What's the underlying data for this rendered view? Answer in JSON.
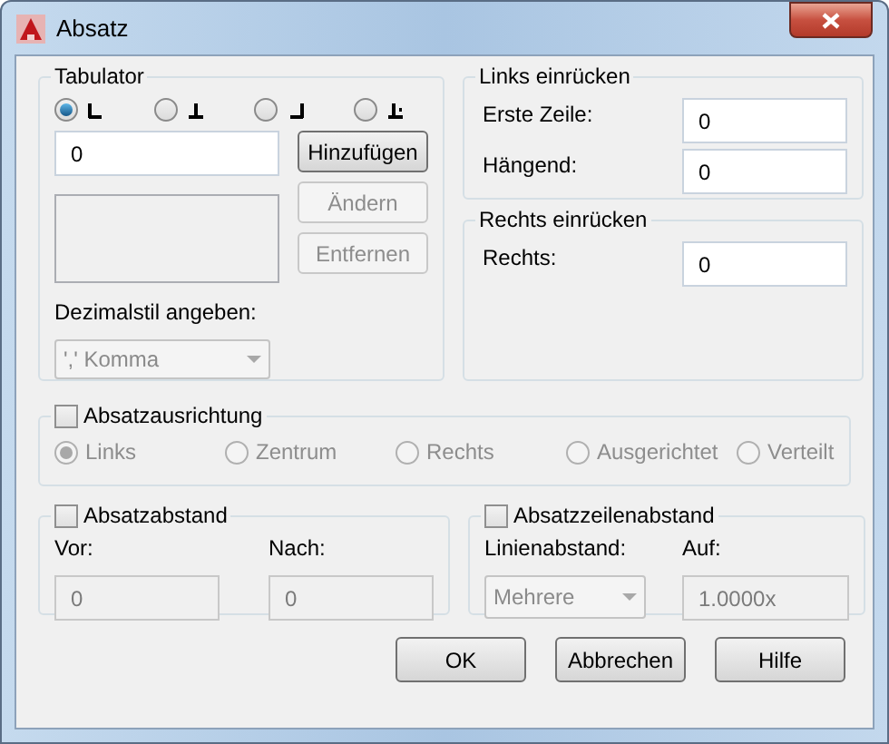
{
  "window": {
    "title": "Absatz"
  },
  "tabulator": {
    "title": "Tabulator",
    "tab_types": [
      {
        "kind": "left",
        "selected": true
      },
      {
        "kind": "center",
        "selected": false
      },
      {
        "kind": "right",
        "selected": false
      },
      {
        "kind": "decimal",
        "selected": false
      }
    ],
    "position": {
      "value": "0"
    },
    "buttons": [
      {
        "label": "Hinzufügen",
        "disabled": false
      },
      {
        "label": "Ändern",
        "disabled": true
      },
      {
        "label": "Entfernen",
        "disabled": true
      }
    ],
    "decimal_label": "Dezimalstil angeben:",
    "decimal_select": {
      "value": "',' Komma",
      "disabled": true
    }
  },
  "left_indent": {
    "title": "Links einrücken",
    "fields": [
      {
        "label": "Erste Zeile:",
        "value": "0"
      },
      {
        "label": "Hängend:",
        "value": "0"
      }
    ]
  },
  "right_indent": {
    "title": "Rechts einrücken",
    "fields": [
      {
        "label": "Rechts:",
        "value": "0"
      }
    ]
  },
  "alignment": {
    "label": "Absatzausrichtung",
    "checked": false,
    "options": [
      {
        "label": "Links",
        "selected": true,
        "disabled": true
      },
      {
        "label": "Zentrum",
        "selected": false,
        "disabled": true
      },
      {
        "label": "Rechts",
        "selected": false,
        "disabled": true
      },
      {
        "label": "Ausgerichtet",
        "selected": false,
        "disabled": true
      },
      {
        "label": "Verteilt",
        "selected": false,
        "disabled": true
      }
    ]
  },
  "spacing": {
    "label": "Absatzabstand",
    "checked": false,
    "fields": [
      {
        "label": "Vor:",
        "value": "0",
        "disabled": true
      },
      {
        "label": "Nach:",
        "value": "0",
        "disabled": true
      }
    ]
  },
  "line_spacing": {
    "label": "Absatzzeilenabstand",
    "checked": false,
    "type_label": "Linienabstand:",
    "type_value": "Mehrere",
    "type_disabled": true,
    "at_label": "Auf:",
    "at_value": "1.0000x",
    "at_disabled": true
  },
  "buttons": [
    {
      "label": "OK"
    },
    {
      "label": "Abbrechen"
    },
    {
      "label": "Hilfe"
    }
  ]
}
